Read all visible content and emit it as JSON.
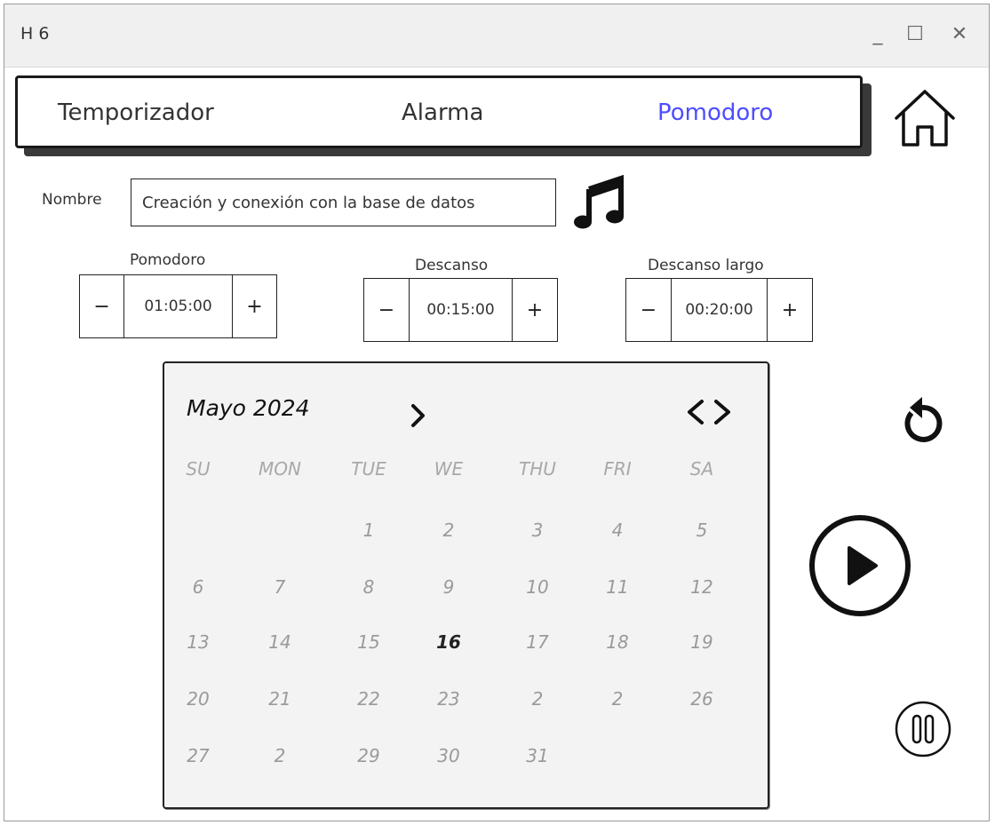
{
  "window": {
    "title": "H 6",
    "minimize": "_",
    "maximize": "☐",
    "close": "✕"
  },
  "tabs": [
    {
      "label": "Temporizador",
      "active": false
    },
    {
      "label": "Alarma",
      "active": false
    },
    {
      "label": "Pomodoro",
      "active": true
    }
  ],
  "accent_color": "#4d4dff",
  "form": {
    "name_label": "Nombre",
    "name_value": "Creación y conexión con la base de datos"
  },
  "timers": [
    {
      "label": "Pomodoro",
      "value": "01:05:00",
      "minus": "−",
      "plus": "+"
    },
    {
      "label": "Descanso",
      "value": "00:15:00",
      "minus": "−",
      "plus": "+"
    },
    {
      "label": "Descanso largo",
      "value": "00:20:00",
      "minus": "−",
      "plus": "+"
    }
  ],
  "calendar": {
    "title": "Mayo 2024",
    "weekdays": [
      "SU",
      "MON",
      "TUE",
      "WE",
      "THU",
      "FRI",
      "SA"
    ],
    "weeks": [
      [
        "",
        "",
        "1",
        "2",
        "3",
        "4",
        "5"
      ],
      [
        "6",
        "7",
        "8",
        "9",
        "10",
        "11",
        "12"
      ],
      [
        "13",
        "14",
        "15",
        "16",
        "17",
        "18",
        "19"
      ],
      [
        "20",
        "21",
        "22",
        "23",
        "2",
        "2",
        "26"
      ],
      [
        "27",
        "2",
        "29",
        "30",
        "31",
        "",
        ""
      ]
    ],
    "today": "16"
  },
  "icons": {
    "home": "home-icon",
    "music": "music-note-icon",
    "reset": "reset-icon",
    "play": "play-icon",
    "pause": "pause-icon"
  }
}
